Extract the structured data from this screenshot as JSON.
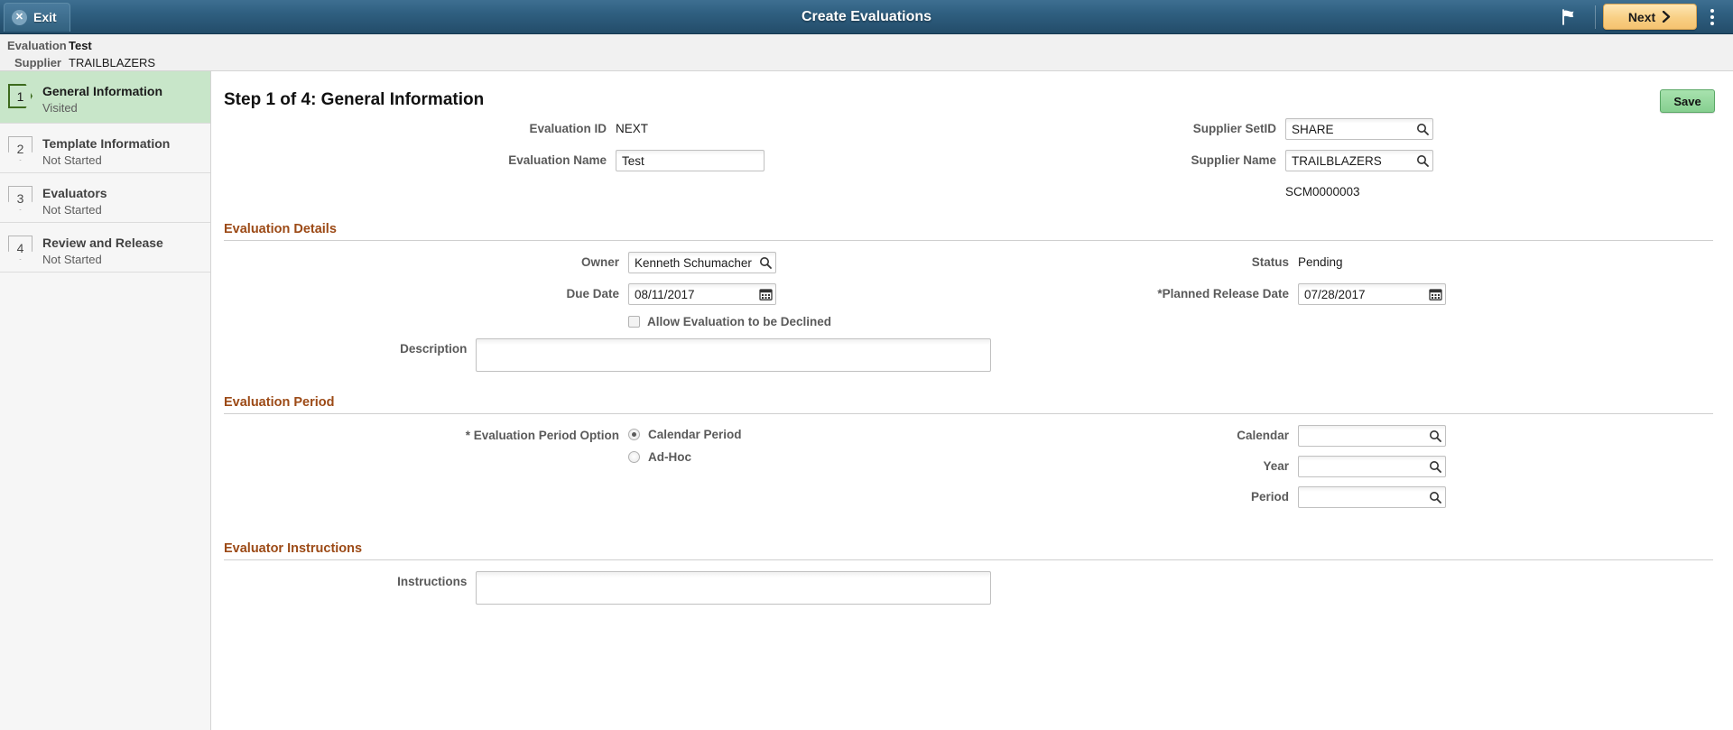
{
  "header": {
    "exit_label": "Exit",
    "title": "Create Evaluations",
    "next_label": "Next",
    "flag_icon": "flag-icon",
    "kebab_icon": "more-actions-icon"
  },
  "breadcrumb": {
    "evaluation_label": "Evaluation",
    "evaluation_value": "Test",
    "supplier_label": "Supplier",
    "supplier_value": "TRAILBLAZERS"
  },
  "sidebar": {
    "steps": [
      {
        "number": "1",
        "title": "General Information",
        "status": "Visited"
      },
      {
        "number": "2",
        "title": "Template Information",
        "status": "Not Started"
      },
      {
        "number": "3",
        "title": "Evaluators",
        "status": "Not Started"
      },
      {
        "number": "4",
        "title": "Review and Release",
        "status": "Not Started"
      }
    ]
  },
  "main": {
    "save_label": "Save",
    "page_title": "Step 1 of 4: General Information",
    "general": {
      "evaluation_id_label": "Evaluation ID",
      "evaluation_id_value": "NEXT",
      "evaluation_name_label": "Evaluation Name",
      "evaluation_name_value": "Test",
      "supplier_setid_label": "Supplier SetID",
      "supplier_setid_value": "SHARE",
      "supplier_name_label": "Supplier Name",
      "supplier_name_value": "TRAILBLAZERS",
      "supplier_id_value": "SCM0000003"
    },
    "evaluation_details": {
      "section_title": "Evaluation Details",
      "owner_label": "Owner",
      "owner_value": "Kenneth Schumacher",
      "status_label": "Status",
      "status_value": "Pending",
      "due_date_label": "Due Date",
      "due_date_value": "08/11/2017",
      "planned_release_label": "*Planned Release Date",
      "planned_release_value": "07/28/2017",
      "allow_decline_label": "Allow Evaluation to be Declined",
      "allow_decline_checked": false,
      "description_label": "Description",
      "description_value": ""
    },
    "evaluation_period": {
      "section_title": "Evaluation Period",
      "option_label": "* Evaluation Period Option",
      "options": [
        {
          "label": "Calendar Period",
          "selected": true
        },
        {
          "label": "Ad-Hoc",
          "selected": false
        }
      ],
      "calendar_label": "Calendar",
      "calendar_value": "",
      "year_label": "Year",
      "year_value": "",
      "period_label": "Period",
      "period_value": ""
    },
    "evaluator_instructions": {
      "section_title": "Evaluator Instructions",
      "instructions_label": "Instructions",
      "instructions_value": ""
    }
  },
  "colors": {
    "header_blue": "#2f5f80",
    "next_orange": "#f8cf84",
    "save_green": "#86cf90",
    "active_step_green": "#c8e6c9",
    "section_brown": "#9c4a16"
  }
}
